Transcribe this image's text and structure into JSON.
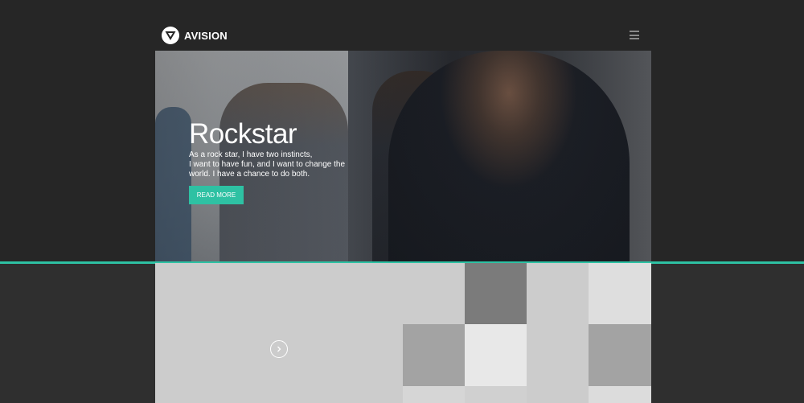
{
  "header": {
    "logo_text": "AVISION",
    "logo_icon": "triangle-shield-icon",
    "menu_icon": "hamburger-menu-icon"
  },
  "hero": {
    "title": "Rockstar",
    "text_lines": [
      "As a rock star, I have two instincts,",
      "I want to have fun, and I want to change the",
      "world. I have a chance to do both."
    ],
    "button_label": "READ MORE"
  },
  "gallery": {
    "next_icon": "chevron-right-icon"
  },
  "colors": {
    "background": "#262626",
    "accent": "#2ec1a3",
    "tile_light": "#cccccc",
    "tile_mid": "#a3a3a3",
    "tile_dark": "#7b7b7b",
    "tile_lighter": "#dedede",
    "tile_lightest": "#e8e8e8"
  }
}
